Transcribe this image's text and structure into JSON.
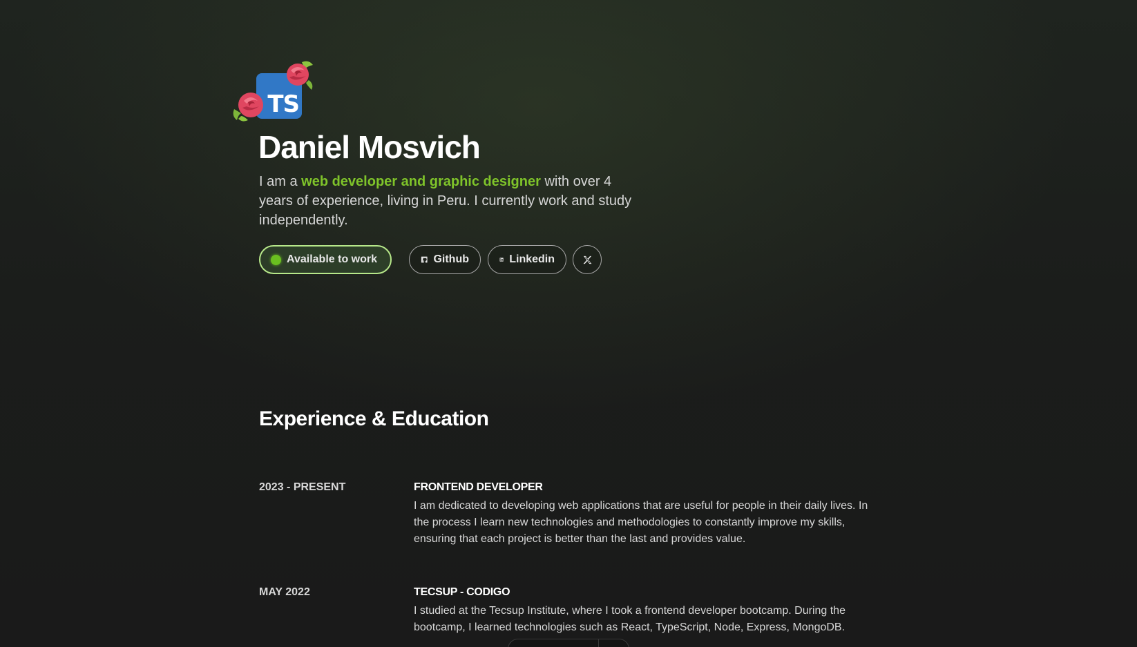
{
  "hero": {
    "avatar_badge": "TS",
    "name": "Daniel Mosvich",
    "bio": {
      "before": "I am a ",
      "highlight": "web developer and graphic designer",
      "after": " with over 4 years of experience, living in Peru. I currently work and study independently."
    },
    "accent_color": "#7fc42a",
    "status_label": "Available to work",
    "links": {
      "github": {
        "label": "Github",
        "icon": "github-icon"
      },
      "linkedin": {
        "label": "Linkedin",
        "icon": "linkedin-icon"
      },
      "x": {
        "icon": "x-icon"
      }
    }
  },
  "experience": {
    "title": "Experience & Education",
    "items": [
      {
        "date": "2023 - PRESENT",
        "role": "FRONTEND DEVELOPER",
        "description": "I am dedicated to developing web applications that are useful for people in their daily lives. In the process I learn new technologies and methodologies to constantly improve my skills, ensuring that each project is better than the last and provides value."
      },
      {
        "date": "MAY 2022",
        "role": "TECSUP - CODIGO",
        "description": "I studied at the Tecsup Institute, where I took a frontend developer bootcamp. During the bootcamp, I learned technologies such as React, TypeScript, Node, Express, MongoDB."
      }
    ]
  }
}
